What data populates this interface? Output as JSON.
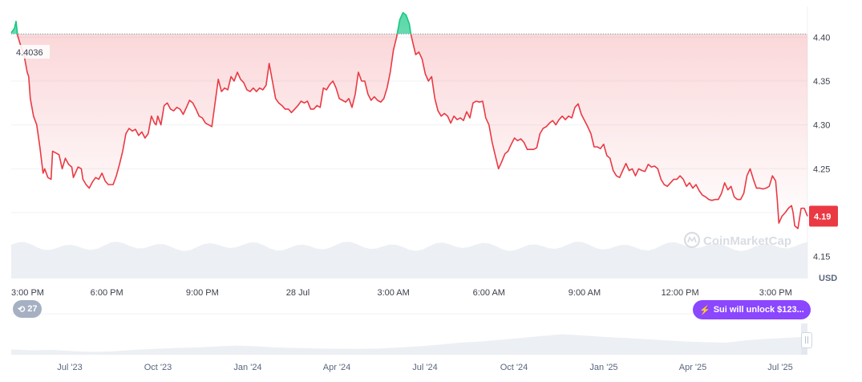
{
  "chart_data": {
    "type": "line",
    "currency": "USD",
    "start_value_label": "4.4036",
    "current_value_label": "4.19",
    "reference_value": 4.4036,
    "ylim": [
      4.125,
      4.435
    ],
    "y_ticks": [
      {
        "value": 4.4,
        "label": "4.40"
      },
      {
        "value": 4.35,
        "label": "4.35"
      },
      {
        "value": 4.3,
        "label": "4.30"
      },
      {
        "value": 4.25,
        "label": "4.25"
      },
      {
        "value": 4.15,
        "label": "4.15"
      }
    ],
    "x_ticks": [
      {
        "t": 0.0,
        "label": "3:00 PM"
      },
      {
        "t": 3.0,
        "label": "6:00 PM"
      },
      {
        "t": 6.0,
        "label": "9:00 PM"
      },
      {
        "t": 9.0,
        "label": "28 Jul"
      },
      {
        "t": 12.0,
        "label": "3:00 AM"
      },
      {
        "t": 15.0,
        "label": "6:00 AM"
      },
      {
        "t": 18.0,
        "label": "9:00 AM"
      },
      {
        "t": 21.0,
        "label": "12:00 PM"
      },
      {
        "t": 24.0,
        "label": "3:00 PM"
      }
    ],
    "x_range": [
      0,
      24.4
    ],
    "series": [
      {
        "points": [
          [
            0.0,
            4.405
          ],
          [
            0.1,
            4.41
          ],
          [
            0.15,
            4.418
          ],
          [
            0.2,
            4.402
          ],
          [
            0.3,
            4.39
          ],
          [
            0.4,
            4.38
          ],
          [
            0.5,
            4.36
          ],
          [
            0.55,
            4.355
          ],
          [
            0.6,
            4.33
          ],
          [
            0.7,
            4.31
          ],
          [
            0.8,
            4.3
          ],
          [
            0.9,
            4.275
          ],
          [
            1.0,
            4.245
          ],
          [
            1.05,
            4.25
          ],
          [
            1.15,
            4.24
          ],
          [
            1.25,
            4.238
          ],
          [
            1.3,
            4.27
          ],
          [
            1.4,
            4.268
          ],
          [
            1.5,
            4.266
          ],
          [
            1.6,
            4.25
          ],
          [
            1.7,
            4.262
          ],
          [
            1.8,
            4.255
          ],
          [
            1.9,
            4.252
          ],
          [
            1.95,
            4.24
          ],
          [
            2.05,
            4.248
          ],
          [
            2.1,
            4.252
          ],
          [
            2.2,
            4.25
          ],
          [
            2.25,
            4.238
          ],
          [
            2.35,
            4.232
          ],
          [
            2.45,
            4.228
          ],
          [
            2.55,
            4.235
          ],
          [
            2.65,
            4.24
          ],
          [
            2.75,
            4.238
          ],
          [
            2.85,
            4.245
          ],
          [
            2.95,
            4.236
          ],
          [
            3.05,
            4.232
          ],
          [
            3.2,
            4.232
          ],
          [
            3.3,
            4.242
          ],
          [
            3.4,
            4.255
          ],
          [
            3.5,
            4.27
          ],
          [
            3.6,
            4.29
          ],
          [
            3.7,
            4.296
          ],
          [
            3.8,
            4.293
          ],
          [
            3.9,
            4.295
          ],
          [
            4.0,
            4.288
          ],
          [
            4.1,
            4.292
          ],
          [
            4.2,
            4.285
          ],
          [
            4.3,
            4.29
          ],
          [
            4.4,
            4.31
          ],
          [
            4.5,
            4.302
          ],
          [
            4.55,
            4.3
          ],
          [
            4.6,
            4.31
          ],
          [
            4.7,
            4.3
          ],
          [
            4.8,
            4.322
          ],
          [
            4.9,
            4.325
          ],
          [
            5.0,
            4.318
          ],
          [
            5.1,
            4.316
          ],
          [
            5.2,
            4.32
          ],
          [
            5.3,
            4.318
          ],
          [
            5.4,
            4.312
          ],
          [
            5.5,
            4.32
          ],
          [
            5.6,
            4.328
          ],
          [
            5.7,
            4.325
          ],
          [
            5.8,
            4.318
          ],
          [
            5.9,
            4.31
          ],
          [
            6.0,
            4.308
          ],
          [
            6.1,
            4.302
          ],
          [
            6.2,
            4.3
          ],
          [
            6.3,
            4.298
          ],
          [
            6.4,
            4.325
          ],
          [
            6.5,
            4.352
          ],
          [
            6.6,
            4.338
          ],
          [
            6.7,
            4.342
          ],
          [
            6.8,
            4.34
          ],
          [
            6.9,
            4.355
          ],
          [
            7.0,
            4.35
          ],
          [
            7.1,
            4.36
          ],
          [
            7.2,
            4.352
          ],
          [
            7.3,
            4.348
          ],
          [
            7.4,
            4.34
          ],
          [
            7.5,
            4.338
          ],
          [
            7.6,
            4.342
          ],
          [
            7.7,
            4.338
          ],
          [
            7.8,
            4.342
          ],
          [
            7.9,
            4.34
          ],
          [
            8.0,
            4.345
          ],
          [
            8.1,
            4.37
          ],
          [
            8.2,
            4.35
          ],
          [
            8.3,
            4.33
          ],
          [
            8.4,
            4.325
          ],
          [
            8.5,
            4.322
          ],
          [
            8.6,
            4.318
          ],
          [
            8.7,
            4.318
          ],
          [
            8.8,
            4.314
          ],
          [
            8.9,
            4.318
          ],
          [
            9.0,
            4.322
          ],
          [
            9.1,
            4.327
          ],
          [
            9.2,
            4.325
          ],
          [
            9.3,
            4.327
          ],
          [
            9.4,
            4.318
          ],
          [
            9.5,
            4.318
          ],
          [
            9.6,
            4.322
          ],
          [
            9.7,
            4.32
          ],
          [
            9.8,
            4.342
          ],
          [
            9.9,
            4.34
          ],
          [
            10.0,
            4.346
          ],
          [
            10.1,
            4.35
          ],
          [
            10.2,
            4.342
          ],
          [
            10.3,
            4.33
          ],
          [
            10.4,
            4.328
          ],
          [
            10.5,
            4.326
          ],
          [
            10.6,
            4.33
          ],
          [
            10.7,
            4.32
          ],
          [
            10.8,
            4.335
          ],
          [
            10.9,
            4.36
          ],
          [
            11.0,
            4.35
          ],
          [
            11.1,
            4.35
          ],
          [
            11.2,
            4.335
          ],
          [
            11.3,
            4.328
          ],
          [
            11.4,
            4.332
          ],
          [
            11.5,
            4.328
          ],
          [
            11.6,
            4.326
          ],
          [
            11.7,
            4.33
          ],
          [
            11.8,
            4.342
          ],
          [
            11.9,
            4.36
          ],
          [
            12.0,
            4.385
          ],
          [
            12.1,
            4.4
          ],
          [
            12.2,
            4.42
          ],
          [
            12.3,
            4.428
          ],
          [
            12.4,
            4.425
          ],
          [
            12.5,
            4.415
          ],
          [
            12.55,
            4.403
          ],
          [
            12.6,
            4.395
          ],
          [
            12.7,
            4.38
          ],
          [
            12.8,
            4.383
          ],
          [
            12.9,
            4.375
          ],
          [
            13.0,
            4.358
          ],
          [
            13.1,
            4.35
          ],
          [
            13.2,
            4.355
          ],
          [
            13.3,
            4.33
          ],
          [
            13.4,
            4.316
          ],
          [
            13.5,
            4.31
          ],
          [
            13.6,
            4.313
          ],
          [
            13.7,
            4.31
          ],
          [
            13.8,
            4.302
          ],
          [
            13.9,
            4.31
          ],
          [
            14.0,
            4.306
          ],
          [
            14.1,
            4.308
          ],
          [
            14.2,
            4.305
          ],
          [
            14.3,
            4.315
          ],
          [
            14.4,
            4.308
          ],
          [
            14.5,
            4.325
          ],
          [
            14.6,
            4.327
          ],
          [
            14.7,
            4.326
          ],
          [
            14.8,
            4.327
          ],
          [
            14.9,
            4.308
          ],
          [
            15.0,
            4.3
          ],
          [
            15.1,
            4.28
          ],
          [
            15.2,
            4.265
          ],
          [
            15.3,
            4.25
          ],
          [
            15.4,
            4.258
          ],
          [
            15.5,
            4.267
          ],
          [
            15.6,
            4.27
          ],
          [
            15.7,
            4.278
          ],
          [
            15.8,
            4.285
          ],
          [
            15.9,
            4.282
          ],
          [
            16.0,
            4.284
          ],
          [
            16.1,
            4.28
          ],
          [
            16.2,
            4.272
          ],
          [
            16.3,
            4.272
          ],
          [
            16.4,
            4.272
          ],
          [
            16.5,
            4.274
          ],
          [
            16.6,
            4.29
          ],
          [
            16.7,
            4.296
          ],
          [
            16.8,
            4.298
          ],
          [
            16.9,
            4.302
          ],
          [
            17.0,
            4.305
          ],
          [
            17.1,
            4.3
          ],
          [
            17.2,
            4.306
          ],
          [
            17.3,
            4.31
          ],
          [
            17.4,
            4.306
          ],
          [
            17.5,
            4.31
          ],
          [
            17.6,
            4.308
          ],
          [
            17.7,
            4.32
          ],
          [
            17.8,
            4.324
          ],
          [
            17.9,
            4.312
          ],
          [
            18.0,
            4.305
          ],
          [
            18.1,
            4.298
          ],
          [
            18.2,
            4.29
          ],
          [
            18.3,
            4.275
          ],
          [
            18.4,
            4.275
          ],
          [
            18.5,
            4.273
          ],
          [
            18.6,
            4.278
          ],
          [
            18.7,
            4.265
          ],
          [
            18.8,
            4.262
          ],
          [
            18.9,
            4.248
          ],
          [
            19.0,
            4.242
          ],
          [
            19.1,
            4.24
          ],
          [
            19.2,
            4.248
          ],
          [
            19.3,
            4.256
          ],
          [
            19.4,
            4.248
          ],
          [
            19.5,
            4.25
          ],
          [
            19.6,
            4.242
          ],
          [
            19.7,
            4.25
          ],
          [
            19.8,
            4.248
          ],
          [
            19.9,
            4.247
          ],
          [
            20.0,
            4.255
          ],
          [
            20.1,
            4.252
          ],
          [
            20.2,
            4.253
          ],
          [
            20.3,
            4.25
          ],
          [
            20.4,
            4.238
          ],
          [
            20.5,
            4.232
          ],
          [
            20.6,
            4.23
          ],
          [
            20.7,
            4.234
          ],
          [
            20.8,
            4.238
          ],
          [
            20.9,
            4.238
          ],
          [
            21.0,
            4.242
          ],
          [
            21.1,
            4.238
          ],
          [
            21.2,
            4.23
          ],
          [
            21.3,
            4.234
          ],
          [
            21.4,
            4.228
          ],
          [
            21.5,
            4.232
          ],
          [
            21.6,
            4.225
          ],
          [
            21.7,
            4.22
          ],
          [
            21.8,
            4.218
          ],
          [
            21.9,
            4.215
          ],
          [
            22.0,
            4.214
          ],
          [
            22.1,
            4.215
          ],
          [
            22.2,
            4.215
          ],
          [
            22.3,
            4.222
          ],
          [
            22.4,
            4.234
          ],
          [
            22.5,
            4.226
          ],
          [
            22.6,
            4.23
          ],
          [
            22.7,
            4.218
          ],
          [
            22.8,
            4.215
          ],
          [
            22.9,
            4.215
          ],
          [
            23.0,
            4.222
          ],
          [
            23.1,
            4.242
          ],
          [
            23.2,
            4.25
          ],
          [
            23.3,
            4.238
          ],
          [
            23.4,
            4.228
          ],
          [
            23.5,
            4.228
          ],
          [
            23.6,
            4.227
          ],
          [
            23.7,
            4.228
          ],
          [
            23.8,
            4.23
          ],
          [
            23.9,
            4.242
          ],
          [
            24.0,
            4.236
          ],
          [
            24.05,
            4.215
          ],
          [
            24.1,
            4.188
          ],
          [
            24.2,
            4.196
          ],
          [
            24.3,
            4.2
          ],
          [
            24.4,
            4.205
          ]
        ]
      }
    ],
    "tail_points": [
      [
        24.4,
        4.205
      ],
      [
        24.5,
        4.208
      ],
      [
        24.55,
        4.2
      ],
      [
        24.6,
        4.185
      ],
      [
        24.7,
        4.182
      ],
      [
        24.8,
        4.205
      ],
      [
        24.9,
        4.205
      ],
      [
        25.0,
        4.196
      ]
    ],
    "navigator": {
      "x_ticks": [
        "Jul '23",
        "Oct '23",
        "Jan '24",
        "Apr '24",
        "Jul '24",
        "Oct '24",
        "Jan '25",
        "Apr '25",
        "Jul '25"
      ]
    }
  },
  "watermark": "CoinMarketCap",
  "controls": {
    "history_count": "27",
    "unlock_label": "Sui will unlock $123..."
  },
  "colors": {
    "down_line": "#ea3943",
    "up_line": "#16c784",
    "badge_bg": "#ea3943",
    "unlock_bg": "#8b46ff"
  }
}
